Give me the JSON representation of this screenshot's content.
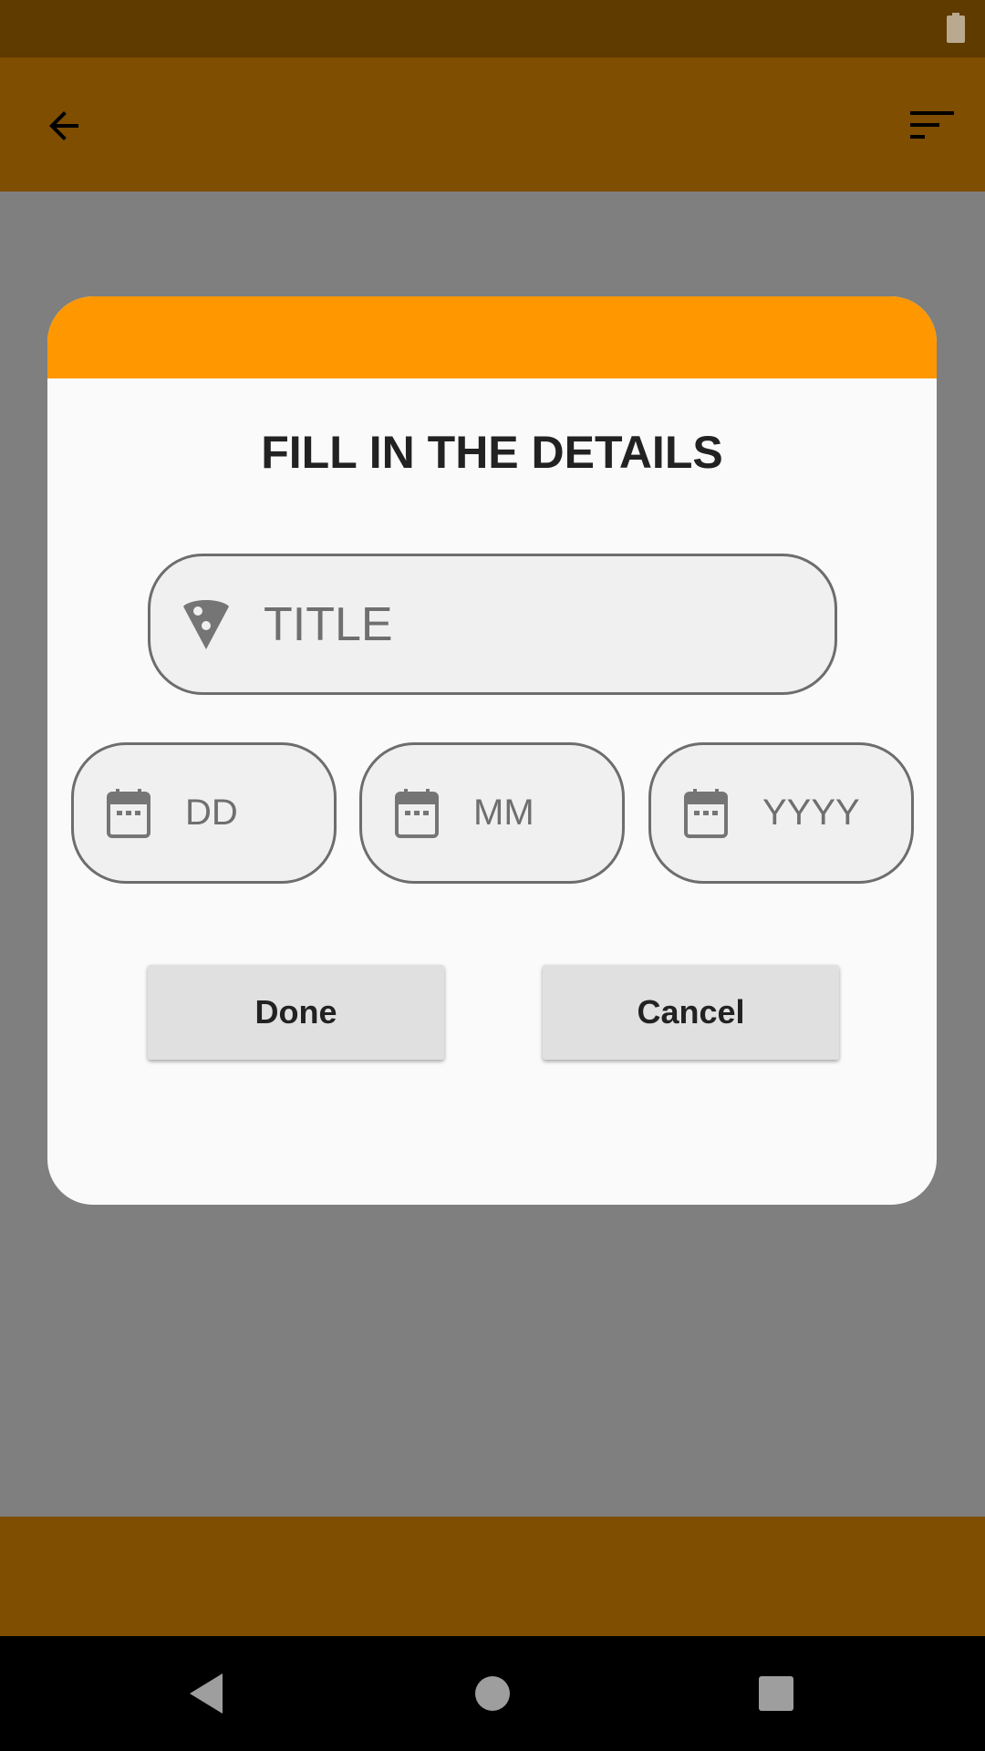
{
  "icons": {
    "battery": "battery-icon",
    "back": "arrow-back-icon",
    "filter": "sort-filter-icon",
    "title": "pizza-slice-icon",
    "date": "calendar-icon",
    "nav_back": "triangle-back-icon",
    "nav_home": "circle-home-icon",
    "nav_recents": "square-recents-icon"
  },
  "colors": {
    "status_bar": "#5f3b00",
    "app_bar": "#7f4e00",
    "dialog_header": "#ff9800",
    "scrim": "#7f7f7f"
  },
  "dialog": {
    "title": "FILL IN THE DETAILS",
    "title_field": {
      "placeholder": "TITLE",
      "value": ""
    },
    "date_fields": [
      {
        "placeholder": "DD",
        "value": ""
      },
      {
        "placeholder": "MM",
        "value": ""
      },
      {
        "placeholder": "YYYY",
        "value": ""
      }
    ],
    "buttons": {
      "done": "Done",
      "cancel": "Cancel"
    }
  }
}
